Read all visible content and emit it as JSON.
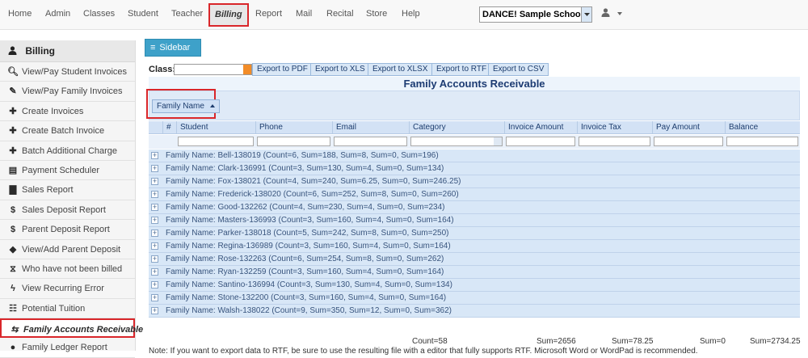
{
  "nav": {
    "items": [
      {
        "label": "Home",
        "active": false
      },
      {
        "label": "Admin",
        "active": false
      },
      {
        "label": "Classes",
        "active": false
      },
      {
        "label": "Student",
        "active": false
      },
      {
        "label": "Teacher",
        "active": false
      },
      {
        "label": "Billing",
        "active": true
      },
      {
        "label": "Report",
        "active": false
      },
      {
        "label": "Mail",
        "active": false
      },
      {
        "label": "Recital",
        "active": false
      },
      {
        "label": "Store",
        "active": false
      },
      {
        "label": "Help",
        "active": false
      }
    ],
    "school_select": "DANCE! Sample School",
    "user_icon": "user-icon"
  },
  "sidebar": {
    "header": "Billing",
    "header_icon": "user-icon",
    "items": [
      {
        "label": "View/Pay Student Invoices",
        "icon": "search-icon",
        "active": false
      },
      {
        "label": "View/Pay Family Invoices",
        "icon": "pencil-icon",
        "active": false
      },
      {
        "label": "Create Invoices",
        "icon": "plus-icon",
        "active": false
      },
      {
        "label": "Create Batch Invoice",
        "icon": "plus-icon",
        "active": false
      },
      {
        "label": "Batch Additional Charge",
        "icon": "plus-icon",
        "active": false
      },
      {
        "label": "Payment Scheduler",
        "icon": "calendar-icon",
        "active": false
      },
      {
        "label": "Sales Report",
        "icon": "bar-chart-icon",
        "active": false
      },
      {
        "label": "Sales Deposit Report",
        "icon": "dollar-icon",
        "active": false
      },
      {
        "label": "Parent Deposit Report",
        "icon": "dollar-icon",
        "active": false
      },
      {
        "label": "View/Add Parent Deposit",
        "icon": "piggy-bank-icon",
        "active": false
      },
      {
        "label": "Who have not been billed",
        "icon": "hourglass-icon",
        "active": false
      },
      {
        "label": "View Recurring Error",
        "icon": "flash-icon",
        "active": false
      },
      {
        "label": "Potential Tuition",
        "icon": "tree-chart-icon",
        "active": false
      },
      {
        "label": "Family Accounts Receivable",
        "icon": "transfer-icon",
        "active": true
      },
      {
        "label": "Family Ledger Report",
        "icon": "user-icon",
        "active": false
      }
    ]
  },
  "toolbar": {
    "sidebar_button": "Sidebar",
    "class_label": "Class:",
    "export_buttons": [
      "Export to PDF",
      "Export to XLS",
      "Export to XLSX",
      "Export to RTF",
      "Export to CSV"
    ]
  },
  "report": {
    "title": "Family Accounts Receivable",
    "group_chip": "Family Name",
    "columns": [
      "#",
      "Student",
      "Phone",
      "Email",
      "Category",
      "Invoice Amount",
      "Invoice Tax",
      "Pay Amount",
      "Balance"
    ],
    "groups": [
      "Family Name: Bell-138019 (Count=6, Sum=188, Sum=8, Sum=0, Sum=196)",
      "Family Name: Clark-136991 (Count=3, Sum=130, Sum=4, Sum=0, Sum=134)",
      "Family Name: Fox-138021 (Count=4, Sum=240, Sum=6.25, Sum=0, Sum=246.25)",
      "Family Name: Frederick-138020 (Count=6, Sum=252, Sum=8, Sum=0, Sum=260)",
      "Family Name: Good-132262 (Count=4, Sum=230, Sum=4, Sum=0, Sum=234)",
      "Family Name: Masters-136993 (Count=3, Sum=160, Sum=4, Sum=0, Sum=164)",
      "Family Name: Parker-138018 (Count=5, Sum=242, Sum=8, Sum=0, Sum=250)",
      "Family Name: Regina-136989 (Count=3, Sum=160, Sum=4, Sum=0, Sum=164)",
      "Family Name: Rose-132263 (Count=6, Sum=254, Sum=8, Sum=0, Sum=262)",
      "Family Name: Ryan-132259 (Count=3, Sum=160, Sum=4, Sum=0, Sum=164)",
      "Family Name: Santino-136994 (Count=3, Sum=130, Sum=4, Sum=0, Sum=134)",
      "Family Name: Stone-132200 (Count=3, Sum=160, Sum=4, Sum=0, Sum=164)",
      "Family Name: Walsh-138022 (Count=9, Sum=350, Sum=12, Sum=0, Sum=362)"
    ],
    "summary": {
      "count": "Count=58",
      "invoice_amount": "Sum=2656",
      "invoice_tax": "Sum=78.25",
      "pay_amount": "Sum=0",
      "balance": "Sum=2734.25"
    },
    "note": "Note: If you want to export data to RTF, be sure to use the resulting file with a editor that fully supports RTF. Microsoft Word or WordPad is recommended."
  }
}
